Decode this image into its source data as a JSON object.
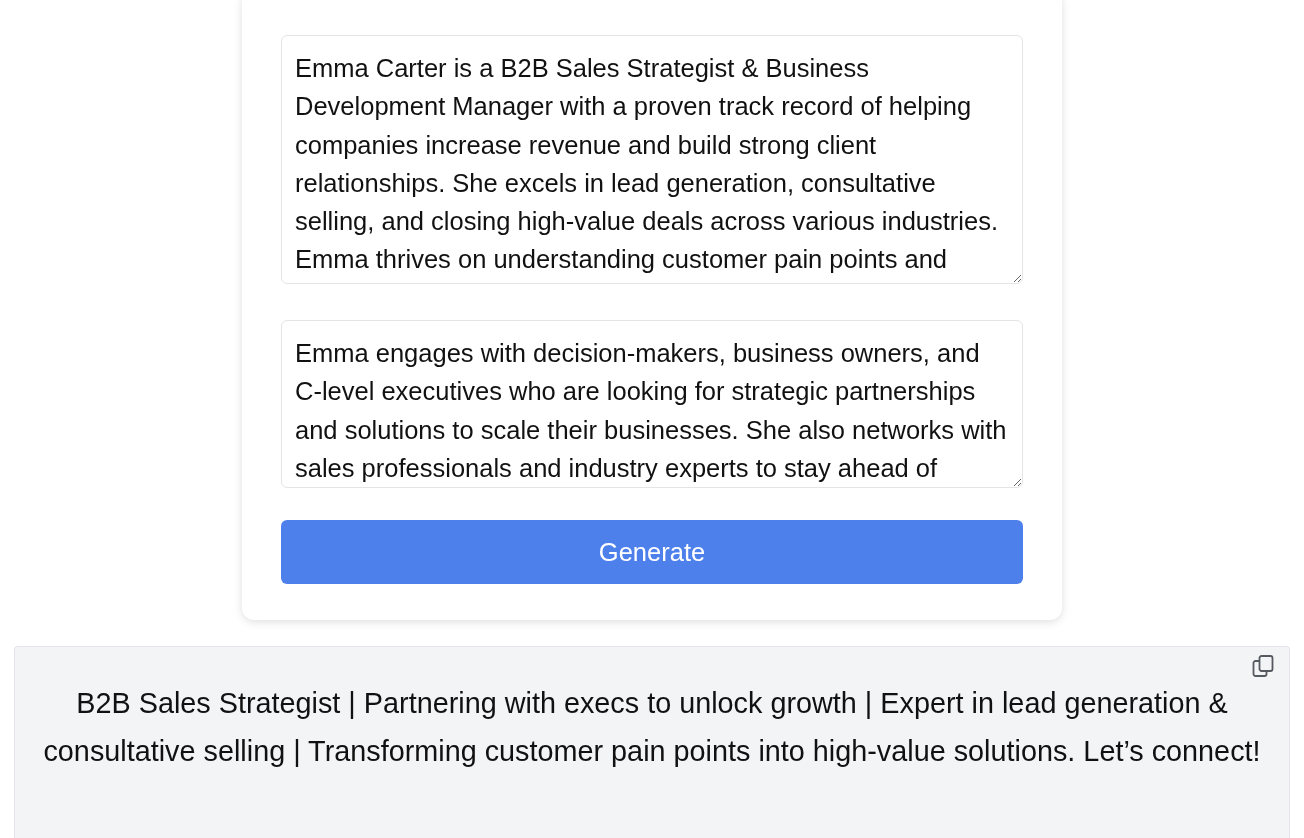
{
  "form": {
    "fields": [
      {
        "value": "Emma Carter is a B2B Sales Strategist & Business Development Manager with a proven track record of helping companies increase revenue and build strong client relationships. She excels in lead generation, consultative selling, and closing high-value deals across various industries. Emma thrives on understanding customer pain points and"
      },
      {
        "value": "Emma engages with decision-makers, business owners, and C-level executives who are looking for strategic partnerships and solutions to scale their businesses. She also networks with sales professionals and industry experts to stay ahead of"
      }
    ],
    "button": {
      "label": "Generate"
    }
  },
  "result": {
    "text": "B2B Sales Strategist | Partnering with execs to unlock growth | Expert in lead generation & consultative selling | Transforming customer pain points into high-value solutions. Let’s connect!"
  }
}
